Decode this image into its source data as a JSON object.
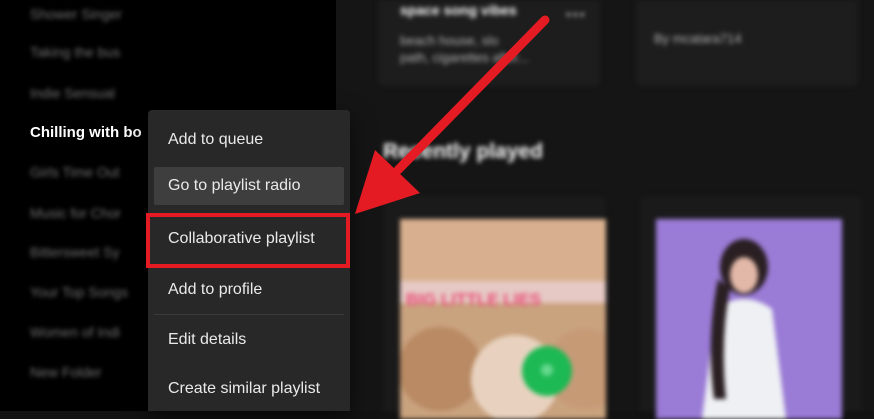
{
  "sidebar": {
    "items": [
      {
        "label": "Shower Singer"
      },
      {
        "label": "Taking the bus"
      },
      {
        "label": "Indie Sensual"
      },
      {
        "label": "Chilling with bo"
      },
      {
        "label": "Girls Time Out"
      },
      {
        "label": "Music for Chor"
      },
      {
        "label": "Bittersweet Sy"
      },
      {
        "label": "Your Top Songs"
      },
      {
        "label": "Women of Indi"
      },
      {
        "label": "New Folder"
      }
    ]
  },
  "main": {
    "top_cards": [
      {
        "title": "space song vibes",
        "subtitle_line1": "beach house, slo",
        "subtitle_line2": "path, cigarettes after..."
      },
      {
        "subtitle": "By mcatara714"
      }
    ],
    "section_title": "Recently played",
    "recent_cards": [
      {
        "banner_text": "BIG LITTLE LIES"
      },
      {}
    ]
  },
  "context_menu": {
    "items": [
      {
        "label": "Add to queue"
      },
      {
        "label": "Go to playlist radio"
      },
      {
        "label": "Collaborative playlist"
      },
      {
        "label": "Add to profile"
      },
      {
        "label": "Edit details"
      },
      {
        "label": "Create similar playlist"
      }
    ]
  },
  "colors": {
    "highlight": "#e51b24",
    "arrow": "#e51b24",
    "menu_bg": "#282828",
    "play_button": "#1db954"
  }
}
